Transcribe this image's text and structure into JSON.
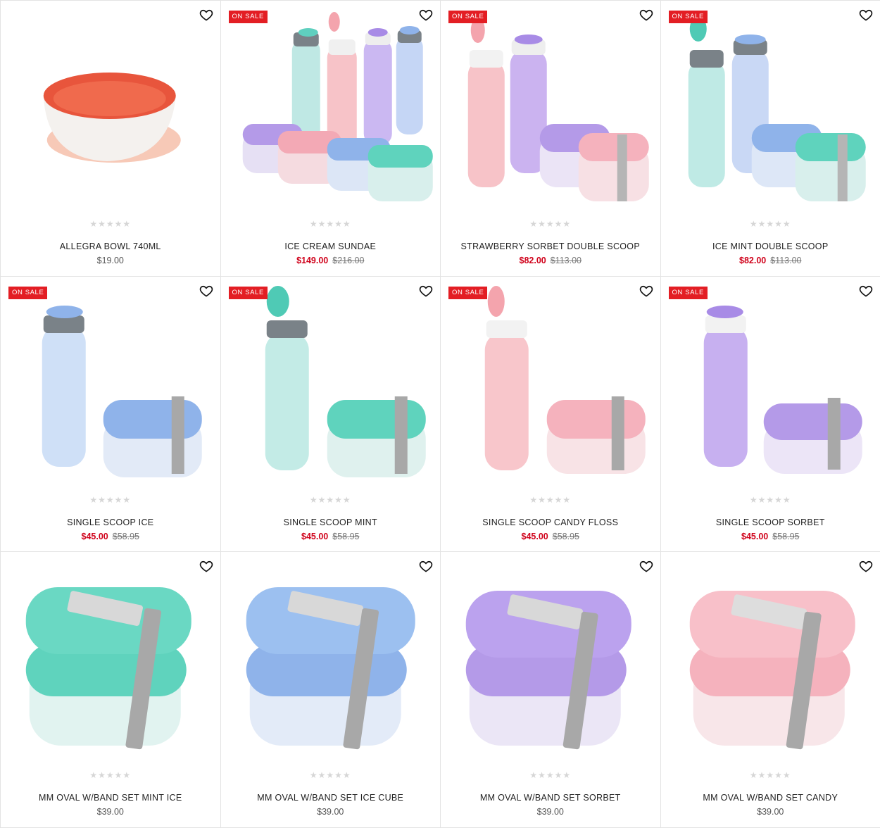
{
  "colors": {
    "sale_badge": "#e31e24",
    "sale_price": "#d0021b"
  },
  "products": [
    {
      "name": "ALLEGRA BOWL 740ML",
      "price": "$19.00",
      "sale_price": "",
      "old_price": "",
      "badge": "",
      "image": "allegra-bowl"
    },
    {
      "name": "ICE CREAM SUNDAE",
      "price": "",
      "sale_price": "$149.00",
      "old_price": "$216.00",
      "badge": "ON SALE",
      "image": "ice-cream-sundae-set"
    },
    {
      "name": "STRAWBERRY SORBET DOUBLE SCOOP",
      "price": "",
      "sale_price": "$82.00",
      "old_price": "$113.00",
      "badge": "ON SALE",
      "image": "strawberry-sorbet-double"
    },
    {
      "name": "ICE MINT DOUBLE SCOOP",
      "price": "",
      "sale_price": "$82.00",
      "old_price": "$113.00",
      "badge": "ON SALE",
      "image": "ice-mint-double"
    },
    {
      "name": "SINGLE SCOOP ICE",
      "price": "",
      "sale_price": "$45.00",
      "old_price": "$58.95",
      "badge": "ON SALE",
      "image": "single-scoop-ice"
    },
    {
      "name": "SINGLE SCOOP MINT",
      "price": "",
      "sale_price": "$45.00",
      "old_price": "$58.95",
      "badge": "ON SALE",
      "image": "single-scoop-mint"
    },
    {
      "name": "SINGLE SCOOP CANDY FLOSS",
      "price": "",
      "sale_price": "$45.00",
      "old_price": "$58.95",
      "badge": "ON SALE",
      "image": "single-scoop-candy-floss"
    },
    {
      "name": "SINGLE SCOOP SORBET",
      "price": "",
      "sale_price": "$45.00",
      "old_price": "$58.95",
      "badge": "ON SALE",
      "image": "single-scoop-sorbet"
    },
    {
      "name": "MM OVAL W/BAND SET MINT ICE",
      "price": "$39.00",
      "sale_price": "",
      "old_price": "",
      "badge": "",
      "image": "oval-set-mint"
    },
    {
      "name": "MM OVAL W/BAND SET ICE CUBE",
      "price": "$39.00",
      "sale_price": "",
      "old_price": "",
      "badge": "",
      "image": "oval-set-blue"
    },
    {
      "name": "MM OVAL W/BAND SET SORBET",
      "price": "$39.00",
      "sale_price": "",
      "old_price": "",
      "badge": "",
      "image": "oval-set-purple"
    },
    {
      "name": "MM OVAL W/BAND SET CANDY",
      "price": "$39.00",
      "sale_price": "",
      "old_price": "",
      "badge": "",
      "image": "oval-set-pink"
    }
  ]
}
